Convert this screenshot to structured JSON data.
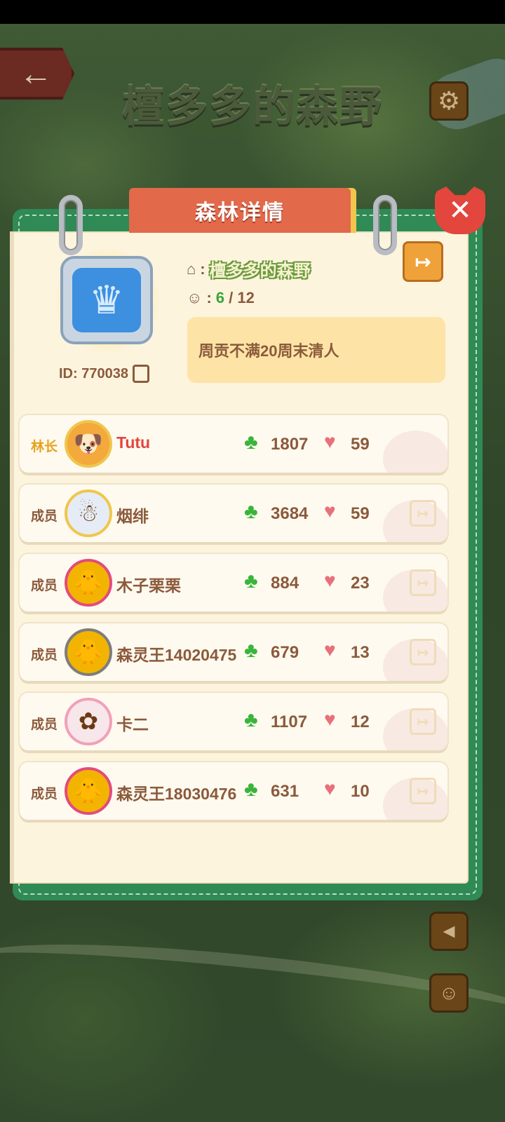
{
  "header": {
    "page_title": "檀多多的森野"
  },
  "modal": {
    "title": "森林详情",
    "forest_name": "檀多多的森野",
    "member_current": "6",
    "member_max": "/ 12",
    "forest_id": "ID: 770038",
    "notice": "周贡不满20周末清人"
  },
  "members": [
    {
      "role": "林长",
      "name": "Tutu",
      "clovers": "1807",
      "hearts": "59"
    },
    {
      "role": "成员",
      "name": "烟绯",
      "clovers": "3684",
      "hearts": "59"
    },
    {
      "role": "成员",
      "name": "木子栗栗",
      "clovers": "884",
      "hearts": "23"
    },
    {
      "role": "成员",
      "name": "森灵王14020475",
      "clovers": "679",
      "hearts": "13"
    },
    {
      "role": "成员",
      "name": "卡二",
      "clovers": "1107",
      "hearts": "12"
    },
    {
      "role": "成员",
      "name": "森灵王18030476",
      "clovers": "631",
      "hearts": "10"
    }
  ],
  "colors": {
    "accent_green": "#2f8a55",
    "title_tab": "#e2694a",
    "close_red": "#e2463d",
    "text_brown": "#8b5a3b",
    "paper": "#fdf4de"
  },
  "icons": {
    "home": "house",
    "members": "people",
    "clover": "clover",
    "heart": "heart",
    "exit": "exit-door"
  }
}
